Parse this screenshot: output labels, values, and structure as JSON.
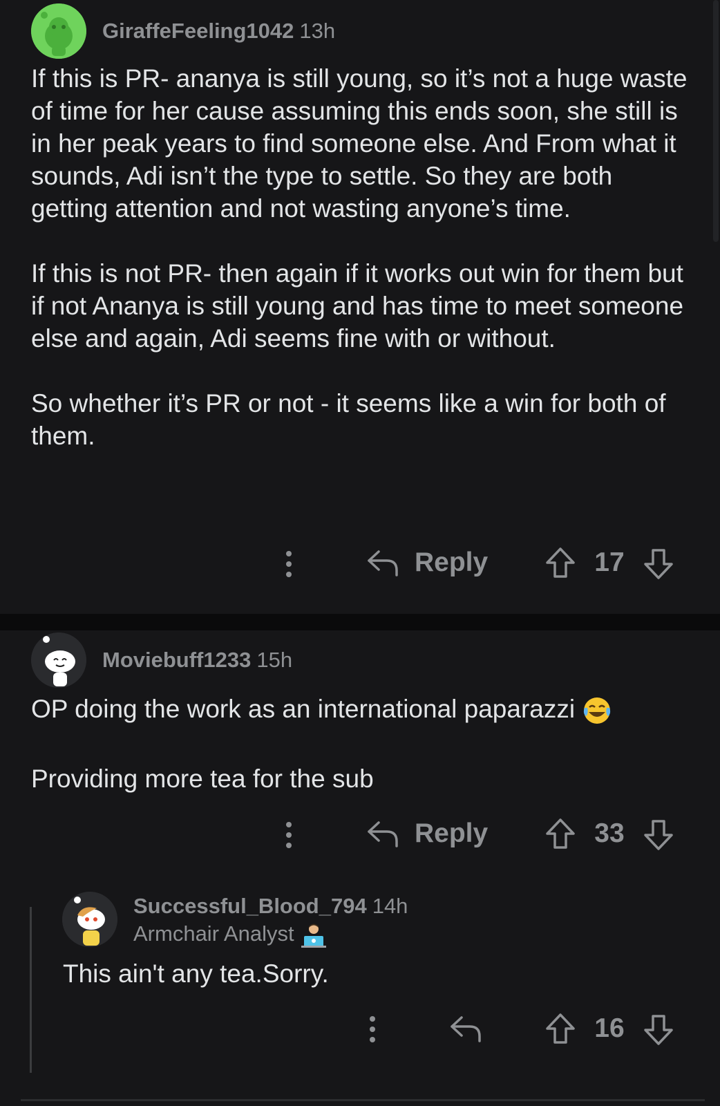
{
  "comments": [
    {
      "username": "GiraffeFeeling1042",
      "time": "13h",
      "paragraphs": [
        "If this is PR- ananya is still young, so it’s not a huge waste of time for her cause assuming this ends soon, she still is in her peak years to find someone else. And From what it sounds, Adi isn’t the type to settle. So they are both getting attention and not wasting anyone’s time.",
        "If this is not PR- then again if it works out win for them but if not Ananya is still young and has time to meet someone else and again, Adi seems fine with or without.",
        "So whether it’s PR or not - it seems like a win for both of them."
      ],
      "reply_label": "Reply",
      "score": "17"
    },
    {
      "username": "Moviebuff1233",
      "time": "15h",
      "paragraphs": [
        "OP doing the work as an international paparazzi",
        "Providing more tea for the sub"
      ],
      "emoji": "face-with-tears-of-joy",
      "reply_label": "Reply",
      "score": "33"
    },
    {
      "username": "Successful_Blood_794",
      "time": "14h",
      "flair": "Armchair Analyst",
      "flair_emoji": "technologist",
      "paragraphs": [
        "This ain't any tea.Sorry."
      ],
      "score": "16"
    }
  ],
  "colors": {
    "background": "#161618",
    "text": "#e3e5e7",
    "muted": "#8f9194",
    "avatar_green": "#6fd35c"
  }
}
